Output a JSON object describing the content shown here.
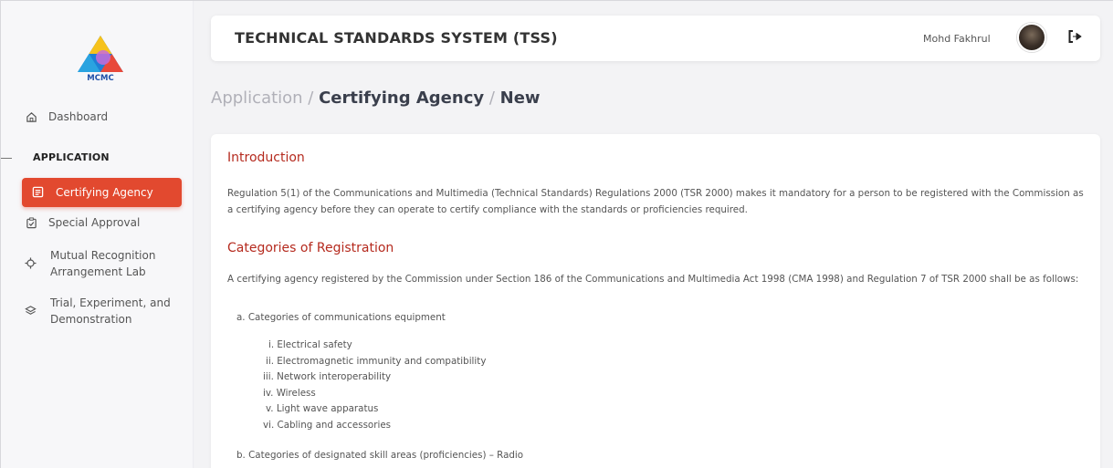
{
  "brand": {
    "logo_text": "MCMC"
  },
  "sidebar": {
    "dashboard_label": "Dashboard",
    "section_label": "APPLICATION",
    "items": [
      {
        "label": "Certifying Agency",
        "active": true,
        "icon": "document-icon"
      },
      {
        "label": "Special Approval",
        "icon": "clipboard-check-icon"
      },
      {
        "label_line1": "Mutual Recognition",
        "label_line2": "Arrangement Lab",
        "icon": "target-icon"
      },
      {
        "label_line1": "Trial, Experiment, and",
        "label_line2": "Demonstration",
        "icon": "layers-icon"
      }
    ]
  },
  "header": {
    "title": "TECHNICAL STANDARDS SYSTEM (TSS)",
    "user_name": "Mohd Fakhrul"
  },
  "breadcrumb": {
    "part1": "Application",
    "sep1": " / ",
    "part2": "Certifying Agency",
    "sep2": " / ",
    "part3": "New"
  },
  "content": {
    "intro_heading": "Introduction",
    "intro_text": "Regulation 5(1) of the Communications and Multimedia (Technical Standards) Regulations 2000 (TSR 2000) makes it mandatory for a person to be registered with the Commission as a certifying agency before they can operate to certify compliance with the standards or proficiencies required.",
    "categories_heading": "Categories of Registration",
    "categories_text": "A certifying agency registered by the Commission under Section 186 of the Communications and Multimedia Act 1998 (CMA 1998) and Regulation 7 of TSR 2000 shall be as follows:",
    "item_a": "a. Categories of communications equipment",
    "sub_items": [
      "i. Electrical safety",
      "ii. Electromagnetic immunity and compatibility",
      "iii. Network interoperability",
      "iv. Wireless",
      "v. Light wave apparatus",
      "vi. Cabling and accessories"
    ],
    "item_b": "b. Categories of designated skill areas (proficiencies) – Radio"
  },
  "colors": {
    "accent": "#e2492f",
    "heading": "#b52a1e"
  }
}
